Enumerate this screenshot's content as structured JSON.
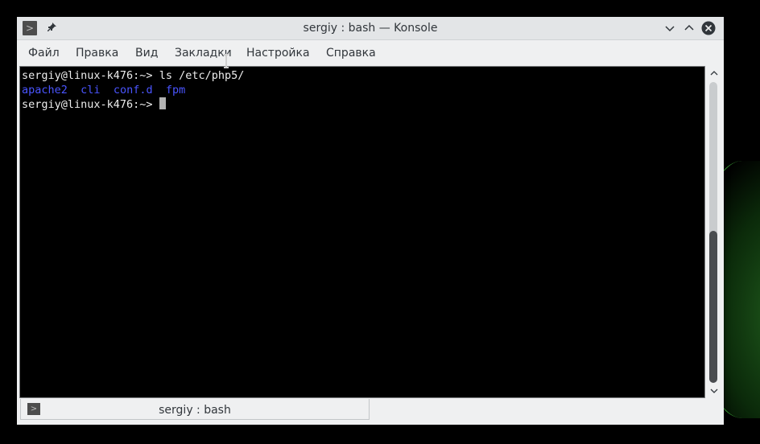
{
  "window": {
    "title": "sergiy : bash — Konsole"
  },
  "menu": {
    "file": "Файл",
    "edit": "Правка",
    "view": "Вид",
    "bookmarks": "Закладки",
    "settings": "Настройка",
    "help": "Справка"
  },
  "terminal": {
    "line1_prompt": "sergiy@linux-k476:~> ",
    "line1_cmd": "ls /etc/php5/",
    "listing": [
      "apache2",
      "cli",
      "conf.d",
      "fpm"
    ],
    "line3_prompt": "sergiy@linux-k476:~> "
  },
  "tabs": [
    {
      "label": "sergiy : bash"
    }
  ],
  "colors": {
    "dir": "#4a55ff",
    "accent_close": "#31363b",
    "glow": "#3fae3a"
  }
}
